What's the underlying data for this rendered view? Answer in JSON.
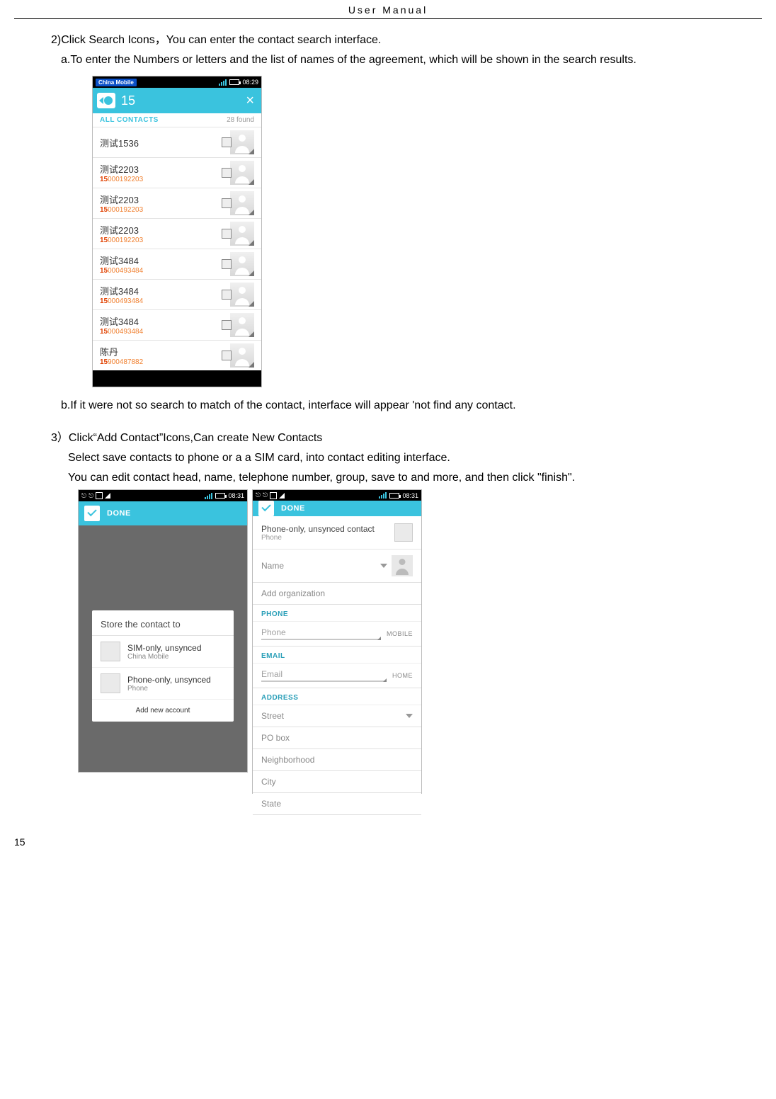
{
  "header": {
    "title": "User  Manual"
  },
  "paragraphs": {
    "p1": "2)Click Search Icons，You can enter the contact search interface.",
    "p2": "a.To enter the Numbers or letters and the list of names of the agreement, which will be shown in the search results.",
    "p3": "b.If it were not so search to match of the contact, interface will appear 'not find any contact.",
    "p4": "3）Click“Add  Contact”Icons,Can create New Contacts",
    "p5": "Select save contacts to phone or a a SIM card, into contact editing interface.",
    "p6": "You can edit contact head, name, telephone number, group, save to and more, and then click \"finish\"."
  },
  "page_number": "15",
  "search_screen": {
    "carrier": "China Mobile",
    "time": "08:29",
    "query": "15",
    "section_label": "ALL CONTACTS",
    "found_text": "28 found",
    "highlight": "15",
    "contacts": [
      {
        "name": "测试1536",
        "number": ""
      },
      {
        "name": "测试2203",
        "number": "000192203"
      },
      {
        "name": "测试2203",
        "number": "000192203"
      },
      {
        "name": "测试2203",
        "number": "000192203"
      },
      {
        "name": "测试3484",
        "number": "000493484"
      },
      {
        "name": "测试3484",
        "number": "000493484"
      },
      {
        "name": "测试3484",
        "number": "000493484"
      },
      {
        "name": "陈丹",
        "number": "900487882"
      }
    ]
  },
  "store_screen": {
    "time": "08:31",
    "done": "DONE",
    "dialog_title": "Store the contact to",
    "opt1_l1": "SIM-only, unsynced",
    "opt1_l2": "China Mobile",
    "opt2_l1": "Phone-only, unsynced",
    "opt2_l2": "Phone",
    "add_account": "Add new account"
  },
  "edit_screen": {
    "time": "08:31",
    "done": "DONE",
    "contact_type_l1": "Phone-only, unsynced contact",
    "contact_type_l2": "Phone",
    "name_placeholder": "Name",
    "add_org": "Add organization",
    "section_phone": "PHONE",
    "phone_placeholder": "Phone",
    "phone_type": "MOBILE",
    "section_email": "EMAIL",
    "email_placeholder": "Email",
    "email_type": "HOME",
    "section_address": "ADDRESS",
    "street": "Street",
    "po_box": "PO box",
    "neighborhood": "Neighborhood",
    "city": "City",
    "state": "State"
  }
}
